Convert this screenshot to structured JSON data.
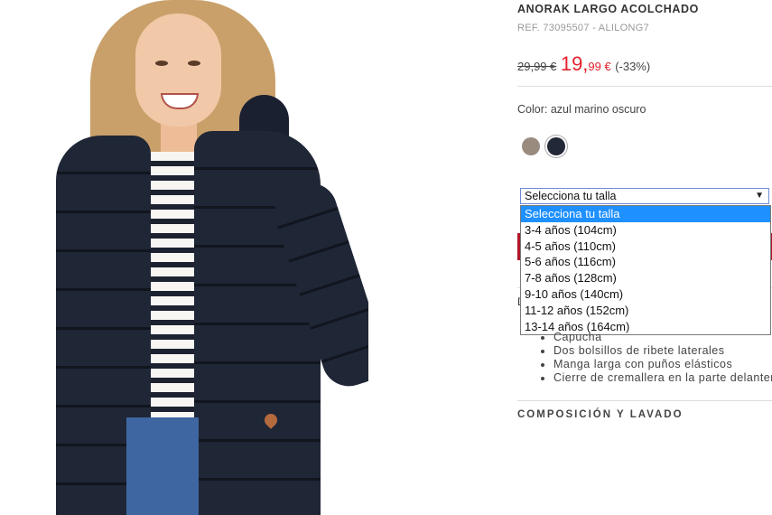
{
  "product": {
    "title": "ANORAK LARGO ACOLCHADO",
    "ref": "REF. 73095507 - ALILONG7",
    "price_old": "29,99 €",
    "price_new_int": "19,",
    "price_new_dec": "99 €",
    "discount": "(-33%)",
    "color_label": "Color: azul marino oscuro",
    "colors": [
      "#9a8b7f",
      "#232838"
    ]
  },
  "size_select": {
    "value": "Selecciona tu talla",
    "options": [
      "Selecciona tu talla",
      "3-4 años (104cm)",
      "4-5 años (110cm)",
      "5-6 años (116cm)",
      "7-8 años (128cm)",
      "9-10 años (140cm)",
      "11-12 años (152cm)",
      "13-14 años (164cm)"
    ]
  },
  "features": [
    "Capucha",
    "Dos bolsillos de ribete laterales",
    "Manga larga con puños elásticos",
    "Cierre de cremallera en la parte delantera"
  ],
  "sections": {
    "composition": "COMPOSICIÓN Y LAVADO"
  }
}
